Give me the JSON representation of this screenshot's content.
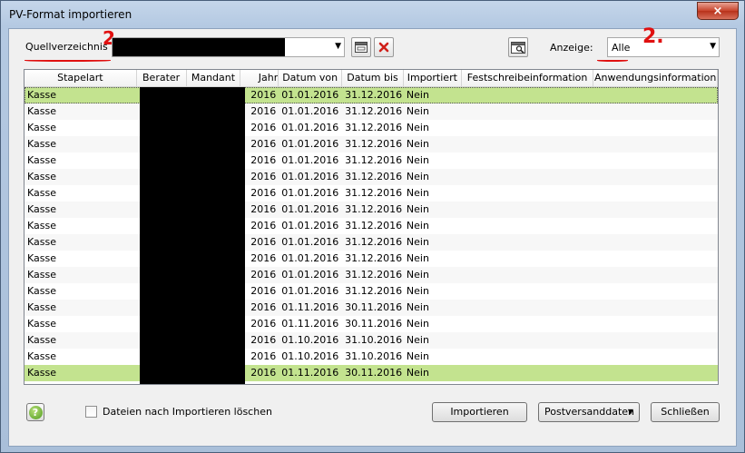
{
  "window": {
    "title": "PV-Format importieren",
    "close_glyph": "×"
  },
  "toolbar": {
    "source_label": "Quellverzeichnis",
    "source_value": "",
    "annotation_mark_1": "2.",
    "anzeige_label": "Anzeige:",
    "anzeige_value": "Alle",
    "annotation_mark_2": "2."
  },
  "icons": {
    "browse": "folder-window-icon",
    "delete": "delete-x-icon",
    "preview": "preview-icon",
    "help": "help-icon"
  },
  "grid": {
    "columns": [
      "Stapelart",
      "Berater",
      "Mandant",
      "Jahr",
      "Datum von",
      "Datum bis",
      "Importiert",
      "Festschreibeinformation",
      "Anwendungsinformation"
    ],
    "rows": [
      {
        "stapelart": "Kasse",
        "jahr": "2016",
        "von": "01.01.2016",
        "bis": "31.12.2016",
        "importiert": "Nein"
      },
      {
        "stapelart": "Kasse",
        "jahr": "2016",
        "von": "01.01.2016",
        "bis": "31.12.2016",
        "importiert": "Nein"
      },
      {
        "stapelart": "Kasse",
        "jahr": "2016",
        "von": "01.01.2016",
        "bis": "31.12.2016",
        "importiert": "Nein"
      },
      {
        "stapelart": "Kasse",
        "jahr": "2016",
        "von": "01.01.2016",
        "bis": "31.12.2016",
        "importiert": "Nein"
      },
      {
        "stapelart": "Kasse",
        "jahr": "2016",
        "von": "01.01.2016",
        "bis": "31.12.2016",
        "importiert": "Nein"
      },
      {
        "stapelart": "Kasse",
        "jahr": "2016",
        "von": "01.01.2016",
        "bis": "31.12.2016",
        "importiert": "Nein"
      },
      {
        "stapelart": "Kasse",
        "jahr": "2016",
        "von": "01.01.2016",
        "bis": "31.12.2016",
        "importiert": "Nein"
      },
      {
        "stapelart": "Kasse",
        "jahr": "2016",
        "von": "01.01.2016",
        "bis": "31.12.2016",
        "importiert": "Nein"
      },
      {
        "stapelart": "Kasse",
        "jahr": "2016",
        "von": "01.01.2016",
        "bis": "31.12.2016",
        "importiert": "Nein"
      },
      {
        "stapelart": "Kasse",
        "jahr": "2016",
        "von": "01.01.2016",
        "bis": "31.12.2016",
        "importiert": "Nein"
      },
      {
        "stapelart": "Kasse",
        "jahr": "2016",
        "von": "01.01.2016",
        "bis": "31.12.2016",
        "importiert": "Nein"
      },
      {
        "stapelart": "Kasse",
        "jahr": "2016",
        "von": "01.01.2016",
        "bis": "31.12.2016",
        "importiert": "Nein"
      },
      {
        "stapelart": "Kasse",
        "jahr": "2016",
        "von": "01.01.2016",
        "bis": "31.12.2016",
        "importiert": "Nein"
      },
      {
        "stapelart": "Kasse",
        "jahr": "2016",
        "von": "01.11.2016",
        "bis": "30.11.2016",
        "importiert": "Nein"
      },
      {
        "stapelart": "Kasse",
        "jahr": "2016",
        "von": "01.11.2016",
        "bis": "30.11.2016",
        "importiert": "Nein"
      },
      {
        "stapelart": "Kasse",
        "jahr": "2016",
        "von": "01.10.2016",
        "bis": "31.10.2016",
        "importiert": "Nein"
      },
      {
        "stapelart": "Kasse",
        "jahr": "2016",
        "von": "01.10.2016",
        "bis": "31.10.2016",
        "importiert": "Nein"
      },
      {
        "stapelart": "Kasse",
        "jahr": "2016",
        "von": "01.11.2016",
        "bis": "30.11.2016",
        "importiert": "Nein"
      }
    ],
    "highlighted_rows": [
      0,
      17
    ]
  },
  "footer": {
    "help_glyph": "?",
    "checkbox_label": "Dateien nach Importieren löschen",
    "checkbox_checked": false,
    "import_button": "Importieren",
    "post_button": "Postversanddaten",
    "close_button": "Schließen"
  },
  "colors": {
    "selected_row": "#c3e38f",
    "annotation": "#e01010"
  }
}
